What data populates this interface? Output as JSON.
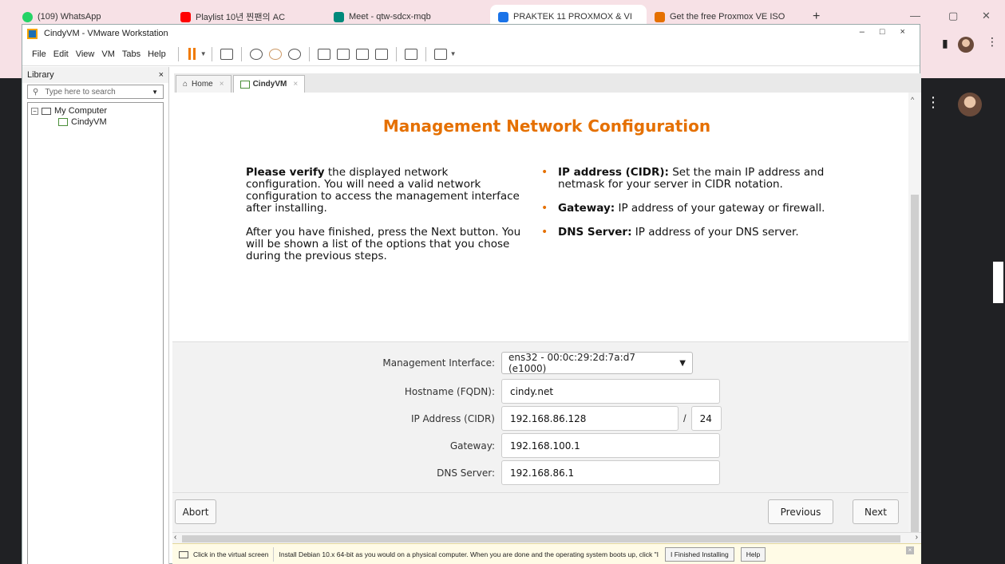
{
  "browser": {
    "tabs": [
      {
        "label": "(109) WhatsApp",
        "icon": "whatsapp-icon",
        "color": "#25d366"
      },
      {
        "label": "Playlist 10년 찐팬의 AC",
        "icon": "youtube-icon",
        "color": "#ff0000"
      },
      {
        "label": "Meet - qtw-sdcx-mqb",
        "icon": "meet-icon",
        "color": "#00897b"
      },
      {
        "label": "PRAKTEK 11 PROXMOX & VI",
        "icon": "drive-icon",
        "color": "#1a73e8"
      },
      {
        "label": "Get the free Proxmox VE ISO",
        "icon": "proxmox-icon",
        "color": "#e57000"
      }
    ],
    "new_tab": "+"
  },
  "vmware": {
    "title": "CindyVM - VMware Workstation",
    "window_controls": "– □ ×",
    "menu": [
      "File",
      "Edit",
      "View",
      "VM",
      "Tabs",
      "Help"
    ],
    "library": {
      "title": "Library",
      "close": "×",
      "search_placeholder": "Type here to search",
      "tree_root": "My Computer",
      "tree_child": "CindyVM"
    },
    "tabs": [
      {
        "label": "Home"
      },
      {
        "label": "CindyVM"
      }
    ],
    "tab_close": "×"
  },
  "installer": {
    "title": "Management Network Configuration",
    "desc_bold": "Please verify",
    "desc_rest": " the displayed network configuration. You will need a valid network configuration to access the management interface after installing.",
    "desc_2": "After you have finished, press the Next button. You will be shown a list of the options that you chose during the previous steps.",
    "bullets": [
      {
        "term": "IP address (CIDR):",
        "text": " Set the main IP address and netmask for your server in CIDR notation."
      },
      {
        "term": "Gateway:",
        "text": " IP address of your gateway or firewall."
      },
      {
        "term": "DNS Server:",
        "text": " IP address of your DNS server."
      }
    ],
    "bullet_glyph": "•",
    "form": {
      "mgmt_label": "Management Interface:",
      "mgmt_value": "ens32 - 00:0c:29:2d:7a:d7 (e1000)",
      "hostname_label": "Hostname (FQDN):",
      "hostname_value": "cindy.net",
      "ip_label": "IP Address (CIDR)",
      "ip_value": "192.168.86.128",
      "cidr_sep": "/",
      "cidr_value": "24",
      "gateway_label": "Gateway:",
      "gateway_value": "192.168.100.1",
      "dns_label": "DNS Server:",
      "dns_value": "192.168.86.1"
    },
    "buttons": {
      "abort": "Abort",
      "previous": "Previous",
      "next": "Next"
    }
  },
  "statusbar": {
    "hint": "Click in the virtual screen",
    "message": "Install Debian 10.x 64-bit as you would on a physical computer. When you are done and the operating system boots up, click \"I",
    "finished_button": "I Finished Installing",
    "help_button": "Help",
    "close": "×"
  },
  "colors": {
    "accent": "#e57000",
    "pause": "#f07a00"
  }
}
